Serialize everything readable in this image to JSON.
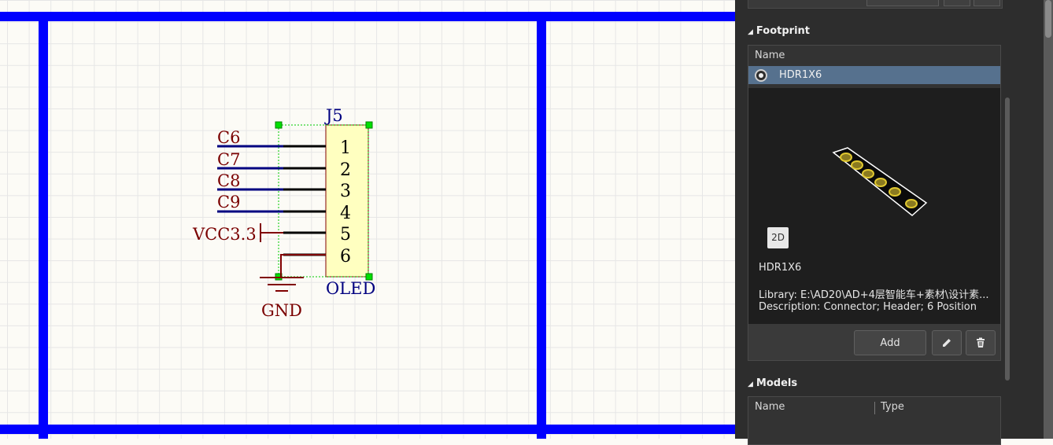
{
  "schematic": {
    "designator": "J5",
    "comment": "OLED",
    "pins": [
      "1",
      "2",
      "3",
      "4",
      "5",
      "6"
    ],
    "nets": [
      "C6",
      "C7",
      "C8",
      "C9"
    ],
    "power_port": "VCC3.3",
    "ground_port": "GND",
    "colors": {
      "border": "#0000ff",
      "net_label": "#7a0000",
      "body": "#ffffc0",
      "designator": "#000080",
      "selection": "#00c800"
    }
  },
  "panel": {
    "footprint": {
      "header": "Footprint",
      "column": "Name",
      "selected": "HDR1X6",
      "view_toggle": "2D",
      "name": "HDR1X6",
      "library_label": "Library:",
      "library_value": "E:\\AD20\\AD+4层智能车+素材\\设计素...",
      "description": "Description: Connector; Header; 6 Position",
      "add_button": "Add",
      "edit_icon": "pencil-icon",
      "delete_icon": "trash-icon"
    },
    "models": {
      "header": "Models",
      "columns": [
        "Name",
        "Type"
      ]
    }
  }
}
